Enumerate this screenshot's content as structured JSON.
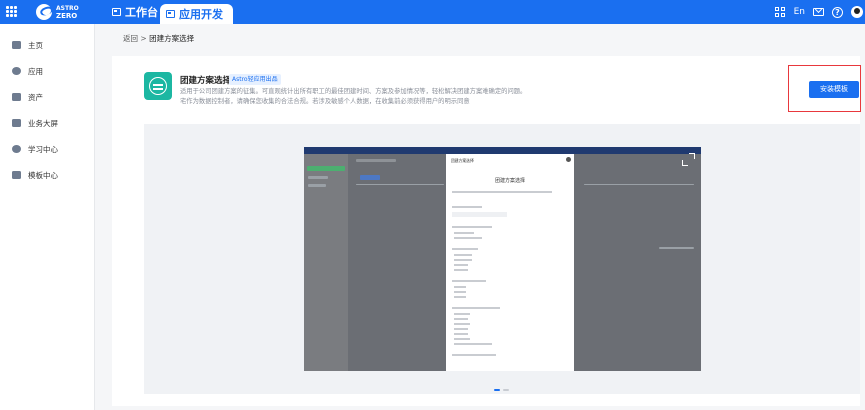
{
  "header": {
    "logo": {
      "line1": "ASTRO",
      "line2": "ZERO"
    },
    "tabs": [
      {
        "label": "工作台",
        "active": false
      },
      {
        "label": "应用开发",
        "active": true
      }
    ],
    "lang": "En",
    "colors": {
      "brand": "#1a6ff0"
    }
  },
  "sidebar": {
    "items": [
      {
        "label": "主页",
        "icon": "home-icon"
      },
      {
        "label": "应用",
        "icon": "app-icon"
      },
      {
        "label": "资产",
        "icon": "asset-icon"
      },
      {
        "label": "业务大屏",
        "icon": "dashboard-icon"
      },
      {
        "label": "学习中心",
        "icon": "learning-icon"
      },
      {
        "label": "模板中心",
        "icon": "template-icon"
      }
    ]
  },
  "breadcrumb": {
    "back": "返回",
    "separator": ">",
    "current": "团建方案选择"
  },
  "template": {
    "title": "团建方案选择",
    "tag": "Astro轻应用出品",
    "desc_line1": "适用于公司团建方案的征集。可直观统计出所有职工的最佳团建时间、方案及参加情况等，轻松解决团建方案难确定的问题。",
    "desc_line2": "宅作为数据控制者，请确保您收集的合法合规。若涉及敏感个人数据，在收集前必须获得用户的明示同意",
    "install_label": "安装模板",
    "accent_color": "#1cb7a2"
  },
  "preview": {
    "modal_header": "团建方案选择",
    "modal_title": "团建方案选择",
    "active_slide": 1,
    "slide_count": 2
  }
}
